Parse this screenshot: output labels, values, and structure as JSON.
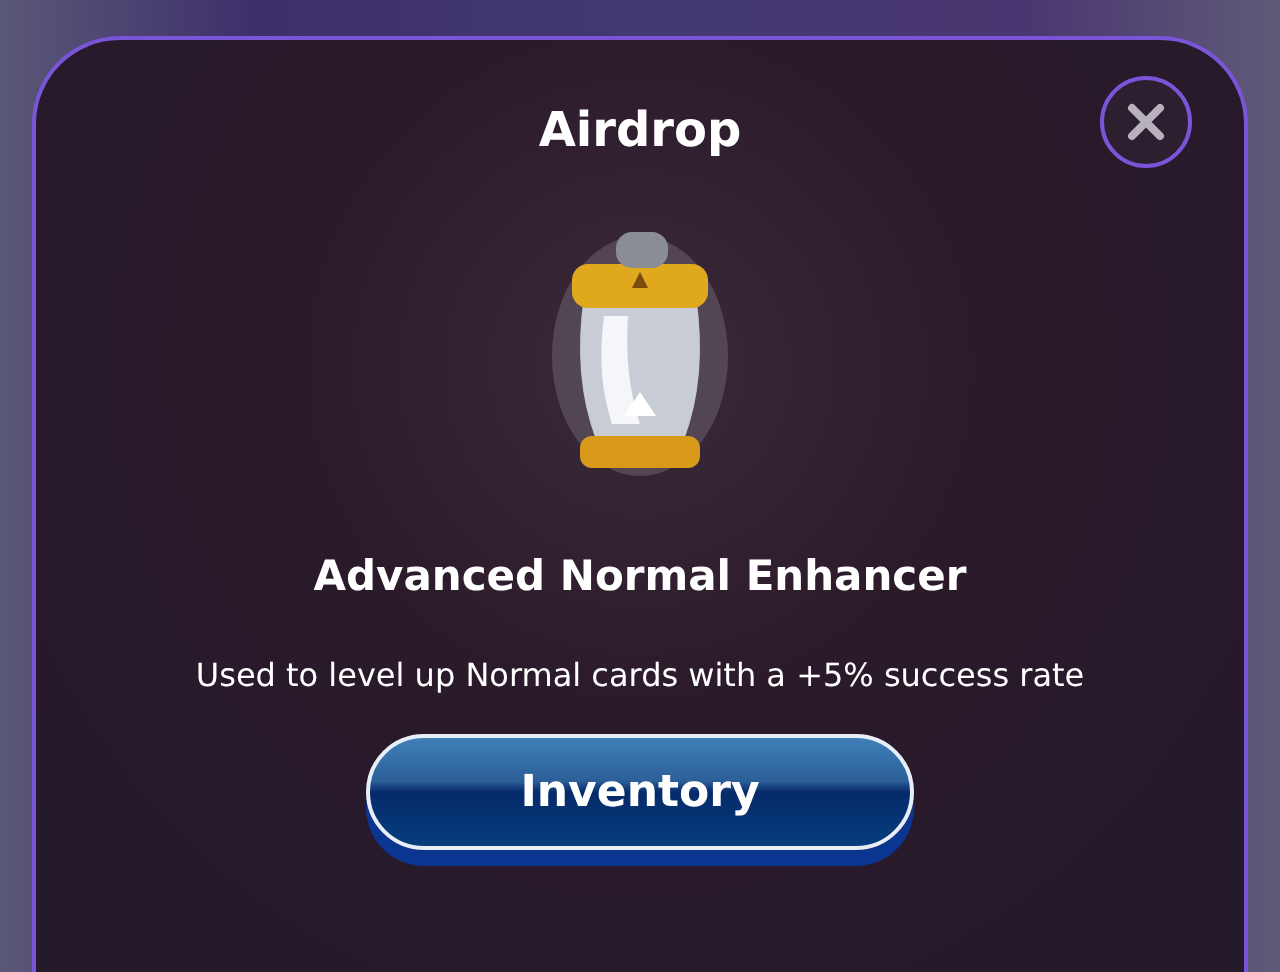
{
  "dialog": {
    "title": "Airdrop",
    "item_name": "Advanced Normal Enhancer",
    "description": "Used to level up Normal cards with a +5% success rate",
    "button": "Inventory"
  }
}
